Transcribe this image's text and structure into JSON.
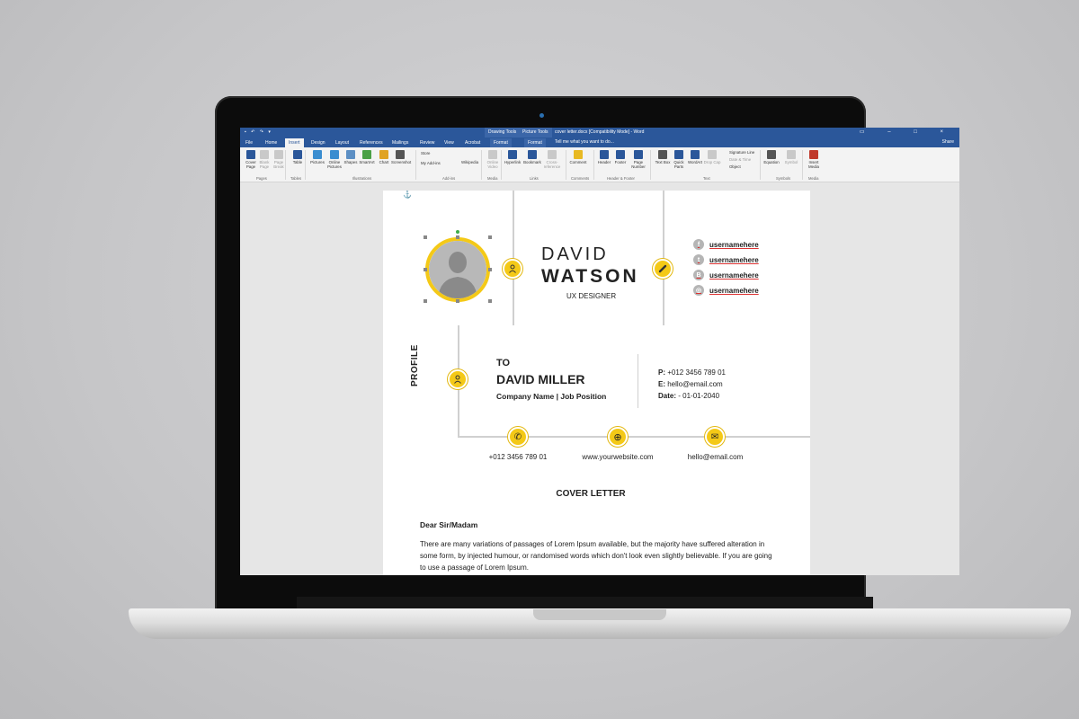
{
  "titlebar": {
    "qat": "▪ ↶ ↷ ▾",
    "ctx_drawing": "Drawing Tools",
    "ctx_picture": "Picture Tools",
    "doc_title": "cover letter.docx [Compatibility Mode] - Word",
    "window_controls": "▭ – □ ×"
  },
  "tabs": [
    "File",
    "Home",
    "Insert",
    "Design",
    "Layout",
    "References",
    "Mailings",
    "Review",
    "View",
    "Acrobat",
    "Format",
    "Format"
  ],
  "tell_me": "Tell me what you want to do...",
  "share": "Share",
  "ribbon": {
    "buttons": [
      {
        "label": "Cover Page",
        "icon": "cover-page-icon",
        "color": "#2b579a"
      },
      {
        "label": "Blank Page",
        "icon": "blank-page-icon",
        "color": "#c9c9c9"
      },
      {
        "label": "Page Break",
        "icon": "page-break-icon",
        "color": "#c9c9c9"
      },
      {
        "label": "Table",
        "icon": "table-icon",
        "color": "#2b579a"
      },
      {
        "label": "Pictures",
        "icon": "pictures-icon",
        "color": "#3a8dd0"
      },
      {
        "label": "Online Pictures",
        "icon": "online-pictures-icon",
        "color": "#3a8dd0"
      },
      {
        "label": "Shapes",
        "icon": "shapes-icon",
        "color": "#5c8fc4"
      },
      {
        "label": "SmartArt",
        "icon": "smartart-icon",
        "color": "#4aa046"
      },
      {
        "label": "Chart",
        "icon": "chart-icon",
        "color": "#e0a323"
      },
      {
        "label": "Screenshot",
        "icon": "screenshot-icon",
        "color": "#555555"
      },
      {
        "label": "Online Video",
        "icon": "online-video-icon",
        "color": "#c9c9c9"
      },
      {
        "label": "Hyperlink",
        "icon": "hyperlink-icon",
        "color": "#2b579a"
      },
      {
        "label": "Bookmark",
        "icon": "bookmark-icon",
        "color": "#2b579a"
      },
      {
        "label": "Cross-reference",
        "icon": "cross-reference-icon",
        "color": "#c9c9c9"
      },
      {
        "label": "Comment",
        "icon": "comment-icon",
        "color": "#e8b923"
      },
      {
        "label": "Header",
        "icon": "header-icon",
        "color": "#2b579a"
      },
      {
        "label": "Footer",
        "icon": "footer-icon",
        "color": "#2b579a"
      },
      {
        "label": "Page Number",
        "icon": "page-number-icon",
        "color": "#2b579a"
      },
      {
        "label": "Text Box",
        "icon": "text-box-icon",
        "color": "#555555"
      },
      {
        "label": "Quick Parts",
        "icon": "quick-parts-icon",
        "color": "#2b579a"
      },
      {
        "label": "WordArt",
        "icon": "wordart-icon",
        "color": "#2b579a"
      },
      {
        "label": "Drop Cap",
        "icon": "drop-cap-icon",
        "color": "#c9c9c9"
      },
      {
        "label": "Equation",
        "icon": "equation-icon",
        "color": "#555555"
      },
      {
        "label": "Symbol",
        "icon": "symbol-icon",
        "color": "#c9c9c9"
      },
      {
        "label": "Insert Media",
        "icon": "insert-media-icon",
        "color": "#c0392b"
      }
    ],
    "addins": {
      "store": "Store",
      "my_addins": "My Add-ins",
      "wikipedia": "Wikipedia"
    },
    "text_small": {
      "signature": "Signature Line",
      "datetime": "Date & Time",
      "object": "Object"
    },
    "groups": [
      "Pages",
      "Tables",
      "Illustrations",
      "Add-ins",
      "Media",
      "Links",
      "Comments",
      "Header & Footer",
      "Text",
      "Symbols",
      "Media"
    ]
  },
  "resume": {
    "first_name": "DAVID",
    "last_name": "WATSON",
    "role": "UX DESIGNER",
    "socials": [
      {
        "icon": "facebook-icon",
        "glyph": "f",
        "handle": "usernamehere"
      },
      {
        "icon": "twitter-icon",
        "glyph": "t",
        "handle": "usernamehere"
      },
      {
        "icon": "vk-icon",
        "glyph": "B",
        "handle": "usernamehere"
      },
      {
        "icon": "instagram-icon",
        "glyph": "◎",
        "handle": "usernamehere"
      }
    ],
    "profile_label": "PROFILE",
    "to_label": "TO",
    "recipient": "DAVID MILLER",
    "company": "Company Name | Job  Position",
    "phone_line": {
      "label": "P:",
      "value": "+012 3456 789 01"
    },
    "email_line": {
      "label": "E:",
      "value": "hello@email.com"
    },
    "date_line": {
      "label": "Date:",
      "value": "- 01-01-2040"
    },
    "contacts": [
      {
        "icon": "phone-icon",
        "glyph": "✆",
        "text": "+012 3456 789 01"
      },
      {
        "icon": "globe-icon",
        "glyph": "⊕",
        "text": "www.yourwebsite.com"
      },
      {
        "icon": "envelope-icon",
        "glyph": "✉",
        "text": "hello@email.com"
      }
    ],
    "cover_title": "COVER LETTER",
    "salutation": "Dear Sir/Madam",
    "body": "There are many variations of passages of Lorem Ipsum available, but the majority have suffered alteration in some form, by injected humour, or randomised words which don't look even slightly believable. If you are going to use a passage of Lorem Ipsum."
  },
  "colors": {
    "word_blue": "#2b579a",
    "accent_yellow": "#f4c917"
  }
}
